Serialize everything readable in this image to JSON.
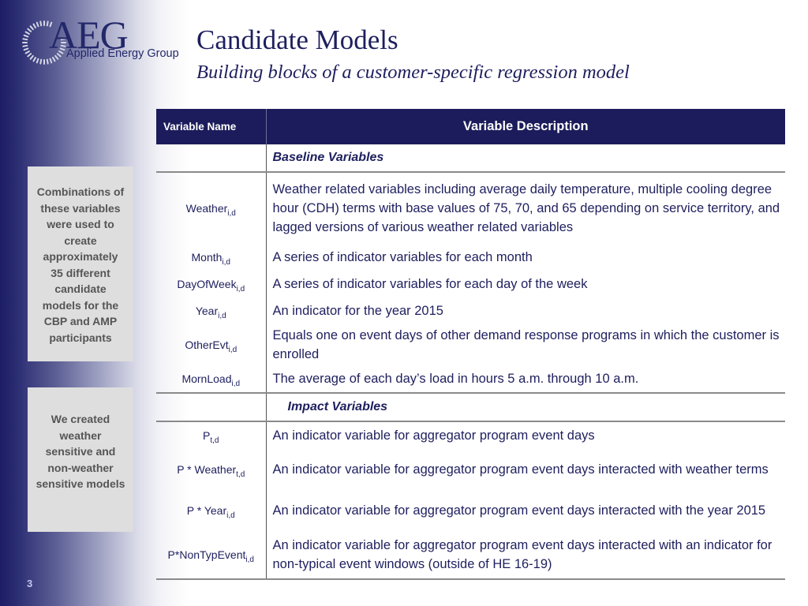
{
  "logo": {
    "brand": "AEG",
    "company": "Applied Energy Group"
  },
  "header": {
    "title": "Candidate Models",
    "subtitle": "Building blocks of a customer-specific regression model"
  },
  "sidebar": {
    "box1": "Combinations of these variables were used to create approximately 35 different candidate models for the CBP and AMP participants",
    "box2": "We created weather sensitive and non-weather sensitive models"
  },
  "page_number": "3",
  "colors": {
    "navy": "#1c1c5c",
    "text": "#1e1f5e",
    "side_box_bg": "#dededf"
  },
  "table": {
    "columns": [
      "Variable Name",
      "Variable Description"
    ],
    "sections": [
      {
        "title": "Baseline Variables",
        "rows": [
          {
            "name": "Weather",
            "sub": "i,d",
            "desc": "Weather related variables including average daily temperature, multiple cooling degree hour (CDH) terms with base values of 75, 70, and 65 depending on service territory, and lagged versions of various weather related variables"
          },
          {
            "name": "Month",
            "sub": "i,d",
            "desc": "A series of indicator variables for each month"
          },
          {
            "name": "DayOfWeek",
            "sub": "i,d",
            "desc": "A series of indicator variables for each day of the week"
          },
          {
            "name": "Year",
            "sub": "i,d",
            "desc": "An indicator for the year 2015"
          },
          {
            "name": "OtherEvt",
            "sub": "i,d",
            "desc": "Equals one on event days of other demand response programs in which the customer is enrolled"
          },
          {
            "name": "MornLoad",
            "sub": "i,d",
            "desc": "The average of each day’s load in hours 5 a.m. through 10 a.m."
          }
        ]
      },
      {
        "title": "Impact Variables",
        "rows": [
          {
            "name": "P",
            "sub": "t,d",
            "desc": "An indicator variable for aggregator program event days"
          },
          {
            "name": "P * Weather",
            "sub": "t,d",
            "desc": "An indicator variable for aggregator program event days interacted with weather terms"
          },
          {
            "name": "P * Year",
            "sub": "i,d",
            "desc": "An indicator variable for aggregator program event days interacted with the year 2015"
          },
          {
            "name": "P*NonTypEvent",
            "sub": "i,d",
            "desc": "An indicator variable for aggregator program event days interacted with an indicator for non-typical event windows (outside of HE 16-19)"
          }
        ]
      }
    ]
  }
}
